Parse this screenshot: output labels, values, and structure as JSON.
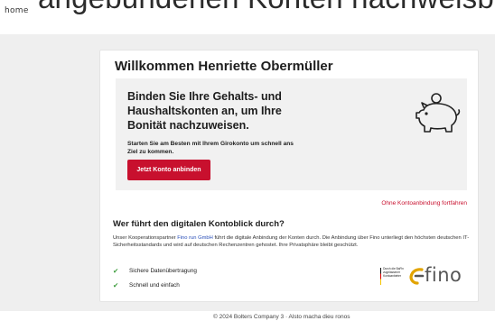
{
  "background_heading": "angebundenen Konten nachweisbar",
  "logo": "home",
  "welcome_title": "Willkommen Henriette Obermüller",
  "promo": {
    "title": "Binden Sie Ihre Gehalts- und Haushaltskonten an, um Ihre Bonität nachzuweisen.",
    "subtitle": "Starten Sie am Besten mit Ihrem Girokonto um schnell ans Ziel zu kommen.",
    "button_label": "Jetzt Konto anbinden",
    "illustration_icon": "piggy-bank-icon"
  },
  "skip_link": "Ohne Kontoanbindung fortfahren",
  "who": {
    "title": "Wer führt den digitalen Kontoblick durch?",
    "text_before": "Unser Kooperationspartner ",
    "partner_link": "Fino run GmbH",
    "text_after": " führt die digitale Anbindung der Konten durch. Die Anbindung über Fino unterliegt den höchsten deutschen IT-Sicherheitsstandards und wird auf deutschen Rechenzentren gehostet. Ihre Privatsphäre bleibt geschützt."
  },
  "features": [
    {
      "icon": "check-icon",
      "label": "Sichere Datenübertragung"
    },
    {
      "icon": "check-icon",
      "label": "Schnell und einfach"
    }
  ],
  "bafin_badge": "Durch die BaFin zugelassener Kontoanbieter",
  "partner_logo": "fino",
  "footer_text": "© 2024 Bolters Company 3 · Alsto macha dieu ronos",
  "colors": {
    "accent": "#c8102e",
    "check": "#3a9b3a",
    "link": "#2a4fb8",
    "page_bg": "#efefef",
    "promo_bg": "#f1f1f1"
  }
}
